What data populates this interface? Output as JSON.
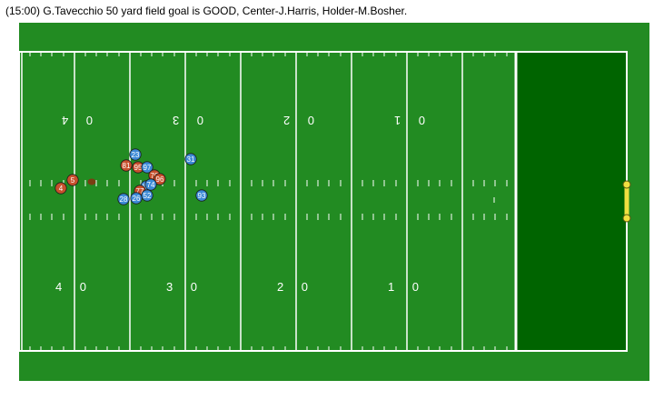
{
  "play_caption": "(15:00) G.Tavecchio 50 yard field goal is GOOD, Center-J.Harris, Holder-M.Bosher.",
  "colors": {
    "grass": "#228b22",
    "endzone": "#006400",
    "lines": "#ffffff",
    "home_team": "#c8502d",
    "away_team": "#3c8ad6",
    "goalpost": "#f0e040",
    "ball": "#7a3d12"
  },
  "yard_numbers": [
    {
      "top": "0 4",
      "bottom": "4 0",
      "yard": 40
    },
    {
      "top": "0 3",
      "bottom": "3 0",
      "yard": 30
    },
    {
      "top": "0 2",
      "bottom": "2 0",
      "yard": 20
    },
    {
      "top": "0 1",
      "bottom": "1 0",
      "yard": 10
    }
  ],
  "players": [
    {
      "number": "23",
      "team": "away"
    },
    {
      "number": "31",
      "team": "away"
    },
    {
      "number": "81",
      "team": "home"
    },
    {
      "number": "95",
      "team": "home"
    },
    {
      "number": "97",
      "team": "away"
    },
    {
      "number": "5",
      "team": "home"
    },
    {
      "number": "4",
      "team": "home"
    },
    {
      "number": "70",
      "team": "home"
    },
    {
      "number": "96",
      "team": "home"
    },
    {
      "number": "64",
      "team": "away"
    },
    {
      "number": "74",
      "team": "away"
    },
    {
      "number": "77",
      "team": "home"
    },
    {
      "number": "52",
      "team": "away"
    },
    {
      "number": "28",
      "team": "away"
    },
    {
      "number": "26",
      "team": "away"
    },
    {
      "number": "93",
      "team": "away"
    }
  ]
}
